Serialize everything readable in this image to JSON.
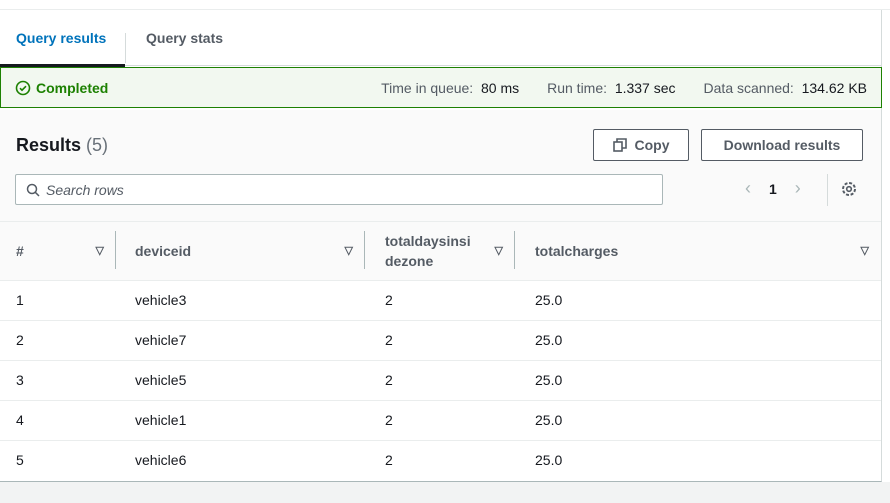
{
  "tabs": [
    {
      "label": "Query results",
      "active": true
    },
    {
      "label": "Query stats",
      "active": false
    }
  ],
  "status": {
    "state": "Completed",
    "time_in_queue_label": "Time in queue:",
    "time_in_queue": "80 ms",
    "run_time_label": "Run time:",
    "run_time": "1.337 sec",
    "data_scanned_label": "Data scanned:",
    "data_scanned": "134.62 KB",
    "color": "#1d8102"
  },
  "results": {
    "title": "Results",
    "count": "(5)",
    "copy_label": "Copy",
    "download_label": "Download results",
    "search_placeholder": "Search rows",
    "page": "1"
  },
  "table": {
    "columns": [
      "#",
      "deviceid",
      "totaldaysinsidezone",
      "totalcharges"
    ],
    "rows": [
      [
        "1",
        "vehicle3",
        "2",
        "25.0"
      ],
      [
        "2",
        "vehicle7",
        "2",
        "25.0"
      ],
      [
        "3",
        "vehicle5",
        "2",
        "25.0"
      ],
      [
        "4",
        "vehicle1",
        "2",
        "25.0"
      ],
      [
        "5",
        "vehicle6",
        "2",
        "25.0"
      ]
    ]
  }
}
